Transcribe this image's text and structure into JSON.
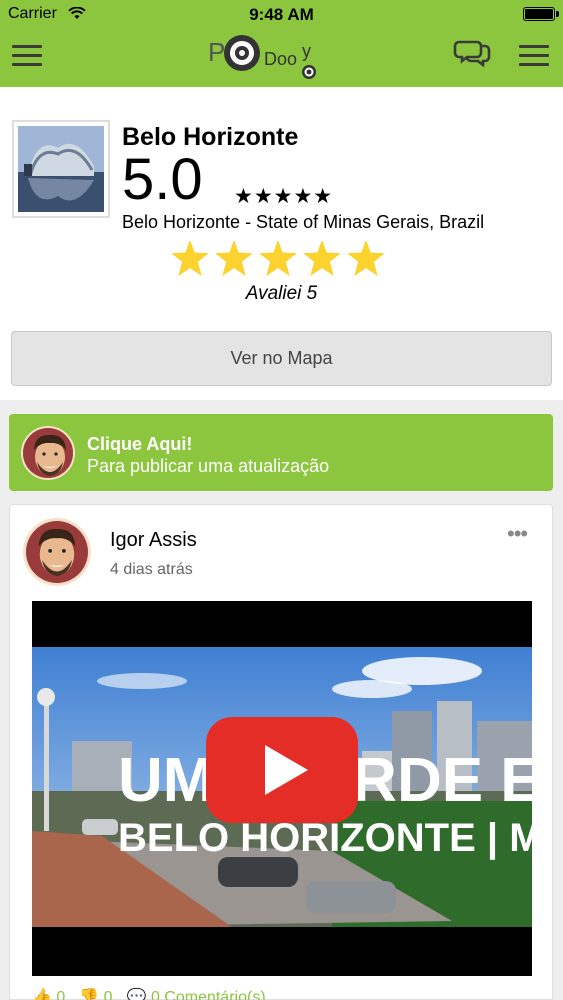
{
  "status_bar": {
    "carrier": "Carrier",
    "time": "9:48 AM"
  },
  "header": {
    "logo_text": "PoDooy",
    "colors": {
      "brand": "#8cc63f",
      "logo_dark": "#333333"
    }
  },
  "place": {
    "name": "Belo Horizonte",
    "score": "5.0",
    "score_stars": "★★★★★",
    "location": "Belo Horizonte - State of Minas Gerais, Brazil",
    "user_rating": 5,
    "user_rating_text": "Avaliei 5",
    "map_button": "Ver no Mapa"
  },
  "composer": {
    "title": "Clique Aqui!",
    "subtitle": "Para publicar uma atualização"
  },
  "post": {
    "author": "Igor Assis",
    "time_ago": "4 dias atrás",
    "video_caption_line1": "UMA TARDE EM",
    "video_caption_line2": "BELO HORIZONTE | MG",
    "likes": "0",
    "dislikes": "0",
    "comments": "0 Comentário(s)"
  }
}
